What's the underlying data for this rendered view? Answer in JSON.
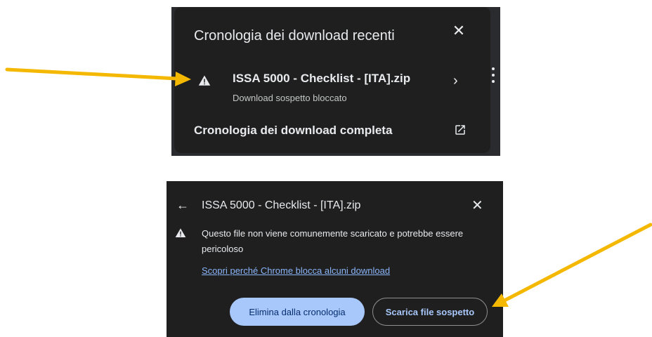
{
  "recent_downloads": {
    "title": "Cronologia dei download recenti",
    "close_icon": "close-icon",
    "item": {
      "icon": "warning-icon",
      "filename": "ISSA 5000 - Checklist - [ITA].zip",
      "status": "Download sospetto bloccato",
      "chevron_icon": "chevron-right-icon"
    },
    "full_history_label": "Cronologia dei download completa",
    "open_external_icon": "open-in-new-icon"
  },
  "detail": {
    "back_icon": "arrow-left-icon",
    "title": "ISSA 5000 - Checklist - [ITA].zip",
    "close_icon": "close-icon",
    "warning_icon": "warning-icon",
    "message": "Questo file non viene comunemente scaricato e potrebbe essere pericoloso",
    "learn_more_link": "Scopri perché Chrome blocca alcuni download",
    "remove_button": "Elimina dalla cronologia",
    "download_button": "Scarica file sospetto"
  },
  "colors": {
    "panel_bg": "#1f1f1f",
    "text": "#e8eaed",
    "link": "#8ab4f8",
    "primary_button_bg": "#a8c7fa",
    "annotation_arrow": "#f5b800"
  }
}
